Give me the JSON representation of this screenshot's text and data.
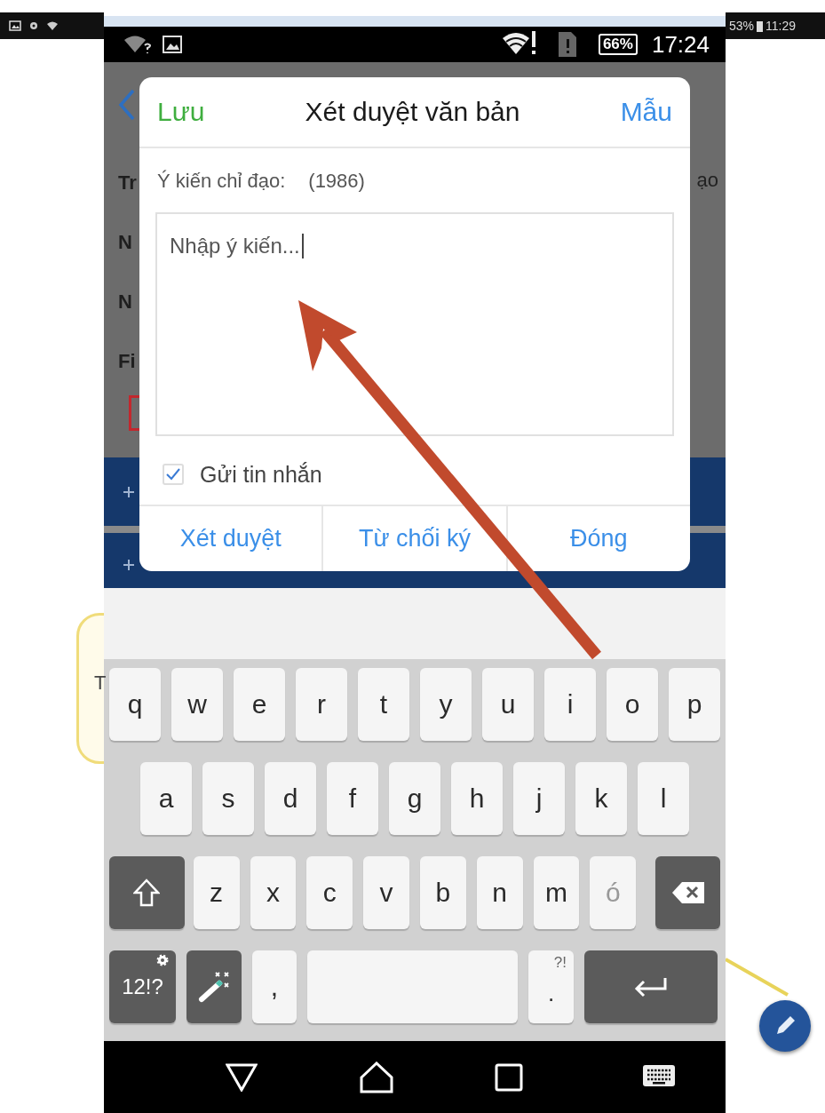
{
  "outer_status_bar": {
    "battery": "53%",
    "time": "11:29"
  },
  "status_bar": {
    "battery": "66%",
    "time": "17:24"
  },
  "background_page": {
    "fragments": [
      {
        "text": "Tr",
        "kind": "left"
      },
      {
        "text": "N",
        "kind": "left"
      },
      {
        "text": "N",
        "kind": "left"
      },
      {
        "text": "Fi",
        "kind": "left"
      },
      {
        "text": "ạo",
        "kind": "right"
      }
    ],
    "bubble_text": "T"
  },
  "dialog": {
    "save": "Lưu",
    "title": "Xét duyệt văn bản",
    "template": "Mẫu",
    "label": "Ý kiến chỉ đạo:",
    "count": "(1986)",
    "placeholder": "Nhập ý kiến...",
    "send_message": {
      "label": "Gửi tin nhắn",
      "checked": true
    },
    "buttons": [
      "Xét duyệt",
      "Từ chối ký",
      "Đóng"
    ]
  },
  "keyboard": {
    "rows": [
      [
        {
          "kind": "letter",
          "text": "q"
        },
        {
          "kind": "letter",
          "text": "w"
        },
        {
          "kind": "letter",
          "text": "e"
        },
        {
          "kind": "letter",
          "text": "r"
        },
        {
          "kind": "letter",
          "text": "t"
        },
        {
          "kind": "letter",
          "text": "y"
        },
        {
          "kind": "letter",
          "text": "u"
        },
        {
          "kind": "letter",
          "text": "i"
        },
        {
          "kind": "letter",
          "text": "o"
        },
        {
          "kind": "letter",
          "text": "p"
        }
      ],
      [
        {
          "kind": "letter",
          "text": "a"
        },
        {
          "kind": "letter",
          "text": "s"
        },
        {
          "kind": "letter",
          "text": "d"
        },
        {
          "kind": "letter",
          "text": "f"
        },
        {
          "kind": "letter",
          "text": "g"
        },
        {
          "kind": "letter",
          "text": "h"
        },
        {
          "kind": "letter",
          "text": "j"
        },
        {
          "kind": "letter",
          "text": "k"
        },
        {
          "kind": "letter",
          "text": "l"
        }
      ],
      [
        {
          "kind": "shift"
        },
        {
          "kind": "letter",
          "text": "z"
        },
        {
          "kind": "letter",
          "text": "x"
        },
        {
          "kind": "letter",
          "text": "c"
        },
        {
          "kind": "letter",
          "text": "v"
        },
        {
          "kind": "letter",
          "text": "b"
        },
        {
          "kind": "letter",
          "text": "n"
        },
        {
          "kind": "letter",
          "text": "m"
        },
        {
          "kind": "accent",
          "text": "ó"
        },
        {
          "kind": "backspace"
        }
      ],
      [
        {
          "kind": "symbols",
          "text": "12!?"
        },
        {
          "kind": "magic"
        },
        {
          "kind": "letter",
          "text": ","
        },
        {
          "kind": "space"
        },
        {
          "kind": "period",
          "text": ".",
          "hint": "?!"
        },
        {
          "kind": "enter"
        }
      ]
    ]
  }
}
